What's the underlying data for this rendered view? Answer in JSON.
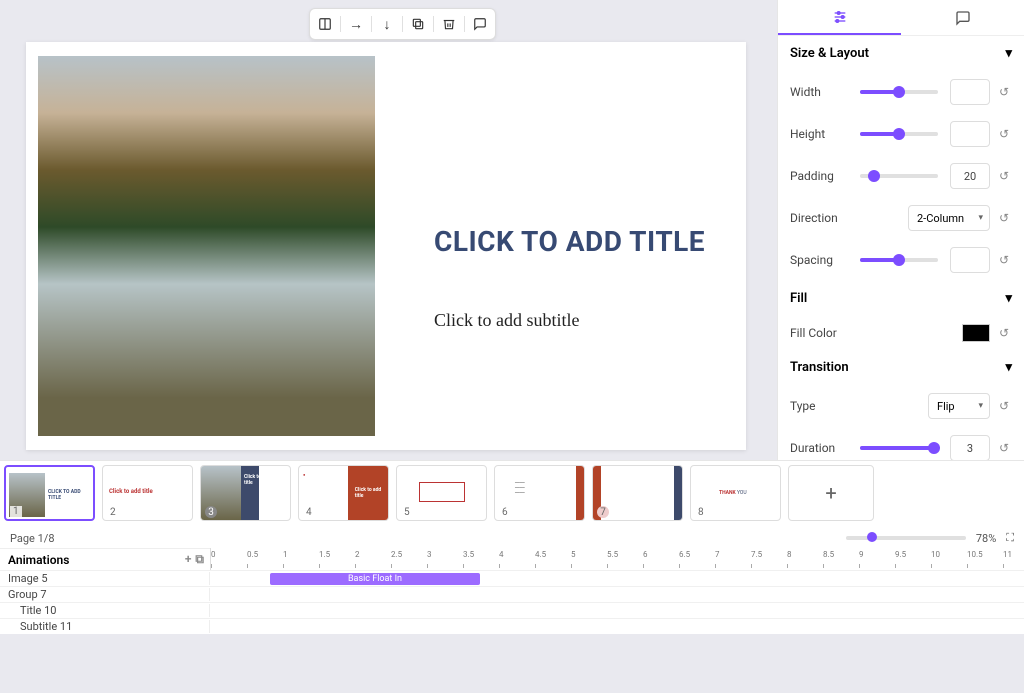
{
  "toolbar": {
    "items": [
      "layout",
      "arrow-right",
      "arrow-down",
      "duplicate",
      "delete",
      "comment"
    ]
  },
  "slide": {
    "title": "CLICK TO ADD TITLE",
    "subtitle": "Click to add subtitle"
  },
  "panel": {
    "section_size": "Size & Layout",
    "width_label": "Width",
    "height_label": "Height",
    "padding_label": "Padding",
    "padding_value": "20",
    "direction_label": "Direction",
    "direction_value": "2-Column",
    "spacing_label": "Spacing",
    "section_fill": "Fill",
    "fillcolor_label": "Fill Color",
    "section_transition": "Transition",
    "type_label": "Type",
    "type_value": "Flip",
    "duration_label": "Duration",
    "duration_value": "3"
  },
  "thumbnails": {
    "count": 8,
    "items": [
      {
        "num": "1"
      },
      {
        "num": "2"
      },
      {
        "num": "3"
      },
      {
        "num": "4"
      },
      {
        "num": "5"
      },
      {
        "num": "6"
      },
      {
        "num": "7"
      },
      {
        "num": "8"
      }
    ]
  },
  "status": {
    "page": "Page 1/8",
    "zoom": "78%"
  },
  "animations": {
    "header": "Animations",
    "rows": [
      "Image 5",
      "Group 7",
      "Title 10",
      "Subtitle 11"
    ],
    "bar_label": "Basic Float In",
    "ruler": [
      "0",
      "0.5",
      "1",
      "1.5",
      "2",
      "2.5",
      "3",
      "3.5",
      "4",
      "4.5",
      "5",
      "5.5",
      "6",
      "6.5",
      "7",
      "7.5",
      "8",
      "8.5",
      "9",
      "9.5",
      "10",
      "10.5",
      "11"
    ]
  }
}
